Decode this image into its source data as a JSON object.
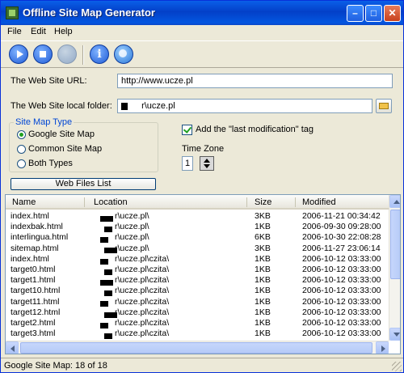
{
  "window": {
    "title": "Offline Site Map Generator",
    "minimize_glyph": "–",
    "maximize_glyph": "□",
    "close_glyph": "✕"
  },
  "menu": {
    "file": "File",
    "edit": "Edit",
    "help": "Help"
  },
  "form": {
    "url_label": "The Web Site URL:",
    "url_value": "http://www.ucze.pl",
    "folder_label": "The Web Site local folder:",
    "folder_value": "r\\ucze.pl",
    "sitemap_type_title": "Site Map Type",
    "sitemap_types": [
      "Google Site Map",
      "Common Site Map",
      "Both Types"
    ],
    "selected_sitemap_type": "Google Site Map",
    "last_mod_label": "Add the \"last modification\" tag",
    "last_mod_checked": true,
    "timezone_label": "Time Zone",
    "timezone_value": "1",
    "web_files_button": "Web Files List"
  },
  "table": {
    "columns": [
      "Name",
      "Location",
      "Size",
      "Modified"
    ],
    "rows": [
      {
        "name": "index.html",
        "location": "r\\ucze.pl\\",
        "size": "3KB",
        "modified": "2006-11-21 00:34:42"
      },
      {
        "name": "indexbak.html",
        "location": "r\\ucze.pl\\",
        "size": "1KB",
        "modified": "2006-09-30 09:28:00"
      },
      {
        "name": "interlingua.html",
        "location": "r\\ucze.pl\\",
        "size": "6KB",
        "modified": "2006-10-30 22:08:28"
      },
      {
        "name": "sitemap.html",
        "location": "r\\ucze.pl\\",
        "size": "3KB",
        "modified": "2006-11-27 23:06:14"
      },
      {
        "name": "index.html",
        "location": "r\\ucze.pl\\czita\\",
        "size": "1KB",
        "modified": "2006-10-12 03:33:00"
      },
      {
        "name": "target0.html",
        "location": "r\\ucze.pl\\czita\\",
        "size": "1KB",
        "modified": "2006-10-12 03:33:00"
      },
      {
        "name": "target1.html",
        "location": "r\\ucze.pl\\czita\\",
        "size": "1KB",
        "modified": "2006-10-12 03:33:00"
      },
      {
        "name": "target10.html",
        "location": "r\\ucze.pl\\czita\\",
        "size": "1KB",
        "modified": "2006-10-12 03:33:00"
      },
      {
        "name": "target11.html",
        "location": "r\\ucze.pl\\czita\\",
        "size": "1KB",
        "modified": "2006-10-12 03:33:00"
      },
      {
        "name": "target12.html",
        "location": "r\\ucze.pl\\czita\\",
        "size": "1KB",
        "modified": "2006-10-12 03:33:00"
      },
      {
        "name": "target2.html",
        "location": "r\\ucze.pl\\czita\\",
        "size": "1KB",
        "modified": "2006-10-12 03:33:00"
      },
      {
        "name": "target3.html",
        "location": "r\\ucze.pl\\czita\\",
        "size": "1KB",
        "modified": "2006-10-12 03:33:00"
      }
    ]
  },
  "status": {
    "text": "Google Site Map: 18 of 18"
  }
}
